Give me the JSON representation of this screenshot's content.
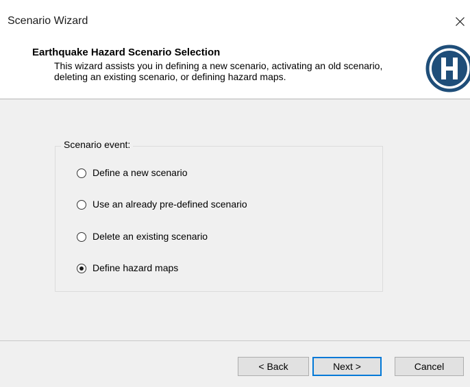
{
  "window": {
    "title": "Scenario Wizard"
  },
  "header": {
    "title": "Earthquake Hazard Scenario Selection",
    "description": "This wizard assists you in defining a new scenario, activating an old scenario, deleting an existing scenario, or defining hazard maps.",
    "logo_letter": "H"
  },
  "group": {
    "label": "Scenario event:",
    "options": [
      {
        "label": "Define a new scenario",
        "selected": false
      },
      {
        "label": "Use an already pre-defined scenario",
        "selected": false
      },
      {
        "label": "Delete an existing scenario",
        "selected": false
      },
      {
        "label": "Define hazard maps",
        "selected": true
      }
    ]
  },
  "footer": {
    "back_label": "< Back",
    "next_label": "Next >",
    "cancel_label": "Cancel"
  },
  "colors": {
    "logo_blue": "#1f4e79",
    "focus_blue": "#0078d7",
    "panel_gray": "#f0f0f0"
  },
  "icons": {
    "close": "close-icon",
    "logo": "hazus-logo-icon"
  }
}
